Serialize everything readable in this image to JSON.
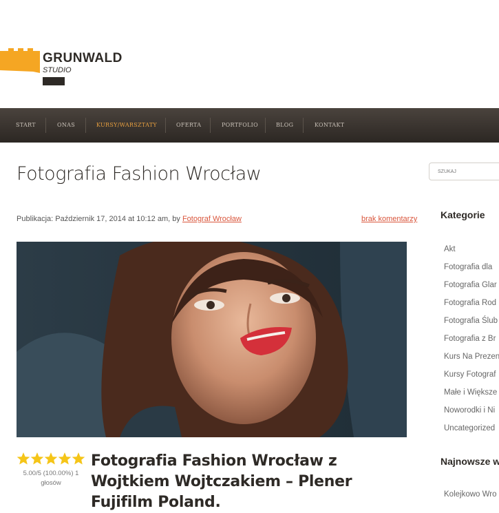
{
  "logo": {
    "name": "GRUNWALD",
    "sub": "STUDIO"
  },
  "nav": {
    "items": [
      {
        "label": "START"
      },
      {
        "label": "ONAS"
      },
      {
        "label": "KURSY/WARSZTATY"
      },
      {
        "label": "OFERTA"
      },
      {
        "label": "PORTFOLIO"
      },
      {
        "label": "BLOG"
      },
      {
        "label": "KONTAKT"
      }
    ],
    "active": "KURSY/WARSZTATY"
  },
  "search": {
    "placeholder": "SZUKAJ"
  },
  "page": {
    "title": "Fotografia Fashion Wrocław",
    "meta_prefix": "Publikacja: Październik 17, 2014 at 10:12 am, by",
    "author": "Fotograf Wrocław",
    "comments": "brak komentarzy"
  },
  "rating": {
    "value": 5,
    "max": 5,
    "text": "5.00/5 (100.00%) 1 głosów"
  },
  "post": {
    "title": "Fotografia Fashion Wrocław z Wojtkiem Wojtczakiem – Plener Fujifilm Poland."
  },
  "sidebar": {
    "categories_title": "Kategorie",
    "categories": [
      "Akt",
      "Fotografia dla",
      "Fotografia Glar",
      "Fotografia Rod",
      "Fotografia Ślub",
      "Fotografia z Br",
      "Kurs Na Prezen",
      "Kursy Fotograf",
      "Małe i Większe",
      "Noworodki i Ni",
      "Uncategorized"
    ],
    "recent_title": "Najnowsze w",
    "recent": [
      "Kolejkowo Wro"
    ]
  },
  "colors": {
    "accent": "#e89f3f",
    "link": "#d9553b",
    "nav_bg": "#3a342f",
    "logo_mark": "#f5a623"
  }
}
